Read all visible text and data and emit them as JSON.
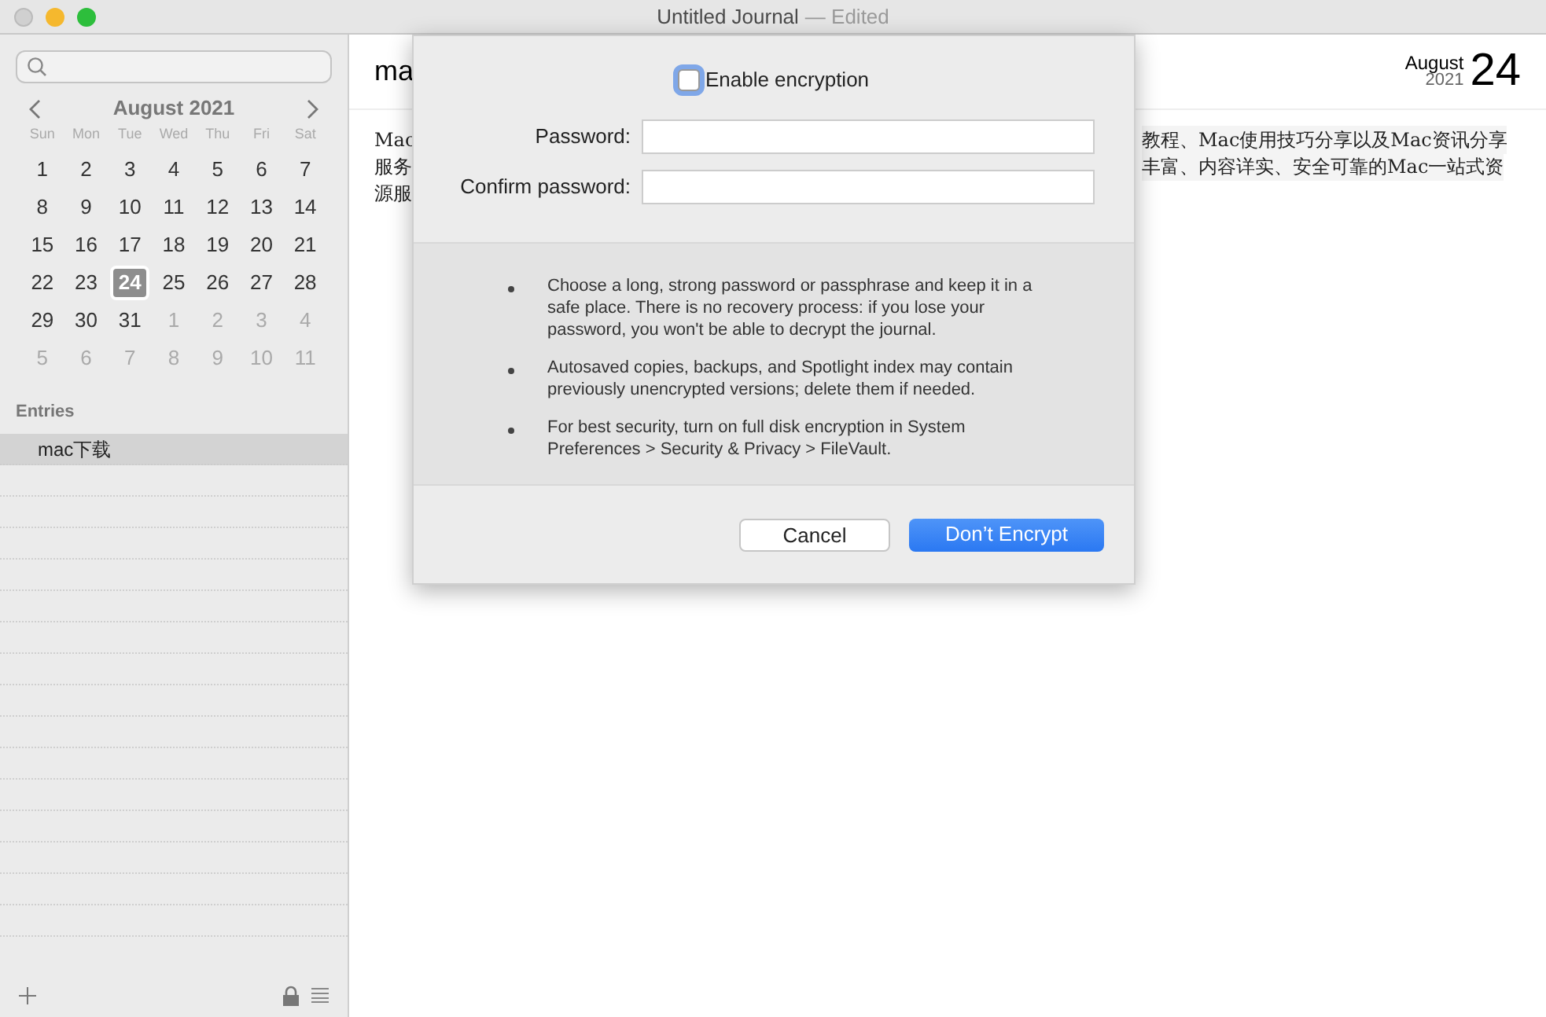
{
  "window": {
    "title": "Untitled Journal",
    "status": "— Edited"
  },
  "sidebar": {
    "calendar": {
      "month": "August 2021",
      "weekdays": [
        "Sun",
        "Mon",
        "Tue",
        "Wed",
        "Thu",
        "Fri",
        "Sat"
      ],
      "days": [
        {
          "label": "1",
          "in_month": true,
          "selected": false
        },
        {
          "label": "2",
          "in_month": true,
          "selected": false
        },
        {
          "label": "3",
          "in_month": true,
          "selected": false
        },
        {
          "label": "4",
          "in_month": true,
          "selected": false
        },
        {
          "label": "5",
          "in_month": true,
          "selected": false
        },
        {
          "label": "6",
          "in_month": true,
          "selected": false
        },
        {
          "label": "7",
          "in_month": true,
          "selected": false
        },
        {
          "label": "8",
          "in_month": true,
          "selected": false
        },
        {
          "label": "9",
          "in_month": true,
          "selected": false
        },
        {
          "label": "10",
          "in_month": true,
          "selected": false
        },
        {
          "label": "11",
          "in_month": true,
          "selected": false
        },
        {
          "label": "12",
          "in_month": true,
          "selected": false
        },
        {
          "label": "13",
          "in_month": true,
          "selected": false
        },
        {
          "label": "14",
          "in_month": true,
          "selected": false
        },
        {
          "label": "15",
          "in_month": true,
          "selected": false
        },
        {
          "label": "16",
          "in_month": true,
          "selected": false
        },
        {
          "label": "17",
          "in_month": true,
          "selected": false
        },
        {
          "label": "18",
          "in_month": true,
          "selected": false
        },
        {
          "label": "19",
          "in_month": true,
          "selected": false
        },
        {
          "label": "20",
          "in_month": true,
          "selected": false
        },
        {
          "label": "21",
          "in_month": true,
          "selected": false
        },
        {
          "label": "22",
          "in_month": true,
          "selected": false
        },
        {
          "label": "23",
          "in_month": true,
          "selected": false
        },
        {
          "label": "24",
          "in_month": true,
          "selected": true
        },
        {
          "label": "25",
          "in_month": true,
          "selected": false
        },
        {
          "label": "26",
          "in_month": true,
          "selected": false
        },
        {
          "label": "27",
          "in_month": true,
          "selected": false
        },
        {
          "label": "28",
          "in_month": true,
          "selected": false
        },
        {
          "label": "29",
          "in_month": true,
          "selected": false
        },
        {
          "label": "30",
          "in_month": true,
          "selected": false
        },
        {
          "label": "31",
          "in_month": true,
          "selected": false
        },
        {
          "label": "1",
          "in_month": false,
          "selected": false
        },
        {
          "label": "2",
          "in_month": false,
          "selected": false
        },
        {
          "label": "3",
          "in_month": false,
          "selected": false
        },
        {
          "label": "4",
          "in_month": false,
          "selected": false
        },
        {
          "label": "5",
          "in_month": false,
          "selected": false
        },
        {
          "label": "6",
          "in_month": false,
          "selected": false
        },
        {
          "label": "7",
          "in_month": false,
          "selected": false
        },
        {
          "label": "8",
          "in_month": false,
          "selected": false
        },
        {
          "label": "9",
          "in_month": false,
          "selected": false
        },
        {
          "label": "10",
          "in_month": false,
          "selected": false
        },
        {
          "label": "11",
          "in_month": false,
          "selected": false
        }
      ]
    },
    "entries_header": "Entries",
    "entries": [
      {
        "title": "mac下载",
        "selected": true
      }
    ]
  },
  "editor": {
    "title": "ma",
    "date": {
      "month": "August",
      "year": "2021",
      "day": "24"
    },
    "lines": [
      {
        "left": "Mac",
        "right": "教程、Mac使用技巧分享以及Mac资讯分享"
      },
      {
        "left": "服务",
        "right": "丰富、内容详实、安全可靠的Mac一站式资"
      },
      {
        "left": "源服"
      }
    ]
  },
  "dialog": {
    "checkbox": {
      "label": "Enable encryption",
      "checked": false
    },
    "fields": [
      {
        "label": "Password:"
      },
      {
        "label": "Confirm password:"
      }
    ],
    "notes": [
      "Choose a long, strong password or passphrase and keep it in a safe place. There is no recovery process: if you lose your password, you won't be able to decrypt the journal.",
      "Autosaved copies, backups, and Spotlight index may contain previously unencrypted versions; delete them if needed.",
      "For best security, turn on full disk encryption in System Preferences > Security & Privacy > FileVault."
    ],
    "buttons": [
      {
        "label": "Cancel",
        "default": false
      },
      {
        "label": "Don’t Encrypt",
        "default": true
      }
    ]
  }
}
